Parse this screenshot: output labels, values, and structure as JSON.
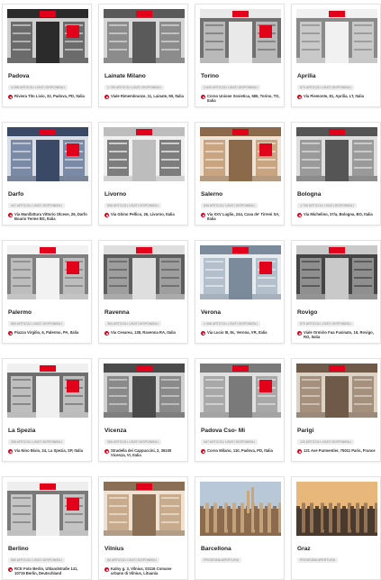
{
  "colors": {
    "accent": "#e2001a",
    "badge_bg": "#ededed",
    "text": "#222222"
  },
  "stores": [
    {
      "city": "Padova",
      "items": "4.398 ARTICOLI USATI DISPONIBILI",
      "address": "Riviera Tito Livio, 32, Padova, PD, Italia",
      "scene": 0
    },
    {
      "city": "Lainate Milano",
      "items": "1.700 ARTICOLI USATI DISPONIBILI",
      "address": "Viale Rimembranze, 11, Lainate, MI, Italia",
      "scene": 1
    },
    {
      "city": "Torino",
      "items": "2.640 ARTICOLI USATI DISPONIBILI",
      "address": "Corso Unione Sovietica, 585, Torino, TO, Italia",
      "scene": 2
    },
    {
      "city": "Aprilia",
      "items": "570 ARTICOLI USATI DISPONIBILI",
      "address": "Via Piemonte, 81, Aprilia, LT, Italia",
      "scene": 3
    },
    {
      "city": "Darfo",
      "items": "447 ARTICOLI USATI DISPONIBILI",
      "address": "Via Manifattura Vittorio Olcese, 26, Darfo Boario Terme BS, Italia",
      "scene": 4
    },
    {
      "city": "Livorno",
      "items": "598 ARTICOLI USATI DISPONIBILI",
      "address": "Via Ghino Pellico, 26, Livorno, Italia",
      "scene": 5
    },
    {
      "city": "Salerno",
      "items": "838 ARTICOLI USATI DISPONIBILI",
      "address": "Via XXV Luglio, 244, Cava de' Tirreni SA, Italia",
      "scene": 6
    },
    {
      "city": "Bologna",
      "items": "1.700 ARTICOLI USATI DISPONIBILI",
      "address": "Via Michelino, 37/a, Bologna, BO, Italia",
      "scene": 7
    },
    {
      "city": "Palermo",
      "items": "550 ARTICOLI USATI DISPONIBILI",
      "address": "Piazza Virgilio, 6, Palermo, PA, Italia",
      "scene": 8
    },
    {
      "city": "Ravenna",
      "items": "364 ARTICOLI USATI DISPONIBILI",
      "address": "Via Cesarea, 138, Ravenna RA, Italia",
      "scene": 9
    },
    {
      "city": "Verona",
      "items": "1.066 ARTICOLI USATI DISPONIBILI",
      "address": "Via Lucio III, 8c, Verona, VR, Italia",
      "scene": 10
    },
    {
      "city": "Rovigo",
      "items": "570 ARTICOLI USATI DISPONIBILI",
      "address": "Viale Ormirio Fua Fusinato, 16, Rovigo, RO, Italia",
      "scene": 11
    },
    {
      "city": "La Spezia",
      "items": "356 ARTICOLI USATI DISPONIBILI",
      "address": "Via Nino Bixio, 24, La Spezia, SP, Italia",
      "scene": 12
    },
    {
      "city": "Vicenza",
      "items": "306 ARTICOLI USATI DISPONIBILI",
      "address": "Stradella dei Cappuccini, 2, 36100 Vicenza, VI, Italia",
      "scene": 13
    },
    {
      "city": "Padova Cso- Mi",
      "items": "447 ARTICOLI USATI DISPONIBILI",
      "address": "Corso Milano, 110, Padova, PD, Italia",
      "scene": 14
    },
    {
      "city": "Parigi",
      "items": "120 ARTICOLI USATI DISPONIBILI",
      "address": "121 Ave Parmentier, 75011 Paris, France",
      "scene": 15
    },
    {
      "city": "Berlino",
      "items": "580 ARTICOLI USATI DISPONIBILI",
      "address": "RCE Foto Berlin, Uhlandstraße 141, 10719 Berlin, Deutschland",
      "scene": 16
    },
    {
      "city": "Vilnius",
      "items": "80 ARTICOLI USATI DISPONIBILI",
      "address": "Kalny g. 3, Vilnius, 03116 Comune urbano di Vilnius, Lituania",
      "scene": 17
    },
    {
      "city": "Barcellona",
      "items": "PROSSIMA APERTURA",
      "address": "",
      "scene": 18
    },
    {
      "city": "Graz",
      "items": "PROSSIMA APERTURA",
      "address": "",
      "scene": 19
    }
  ]
}
